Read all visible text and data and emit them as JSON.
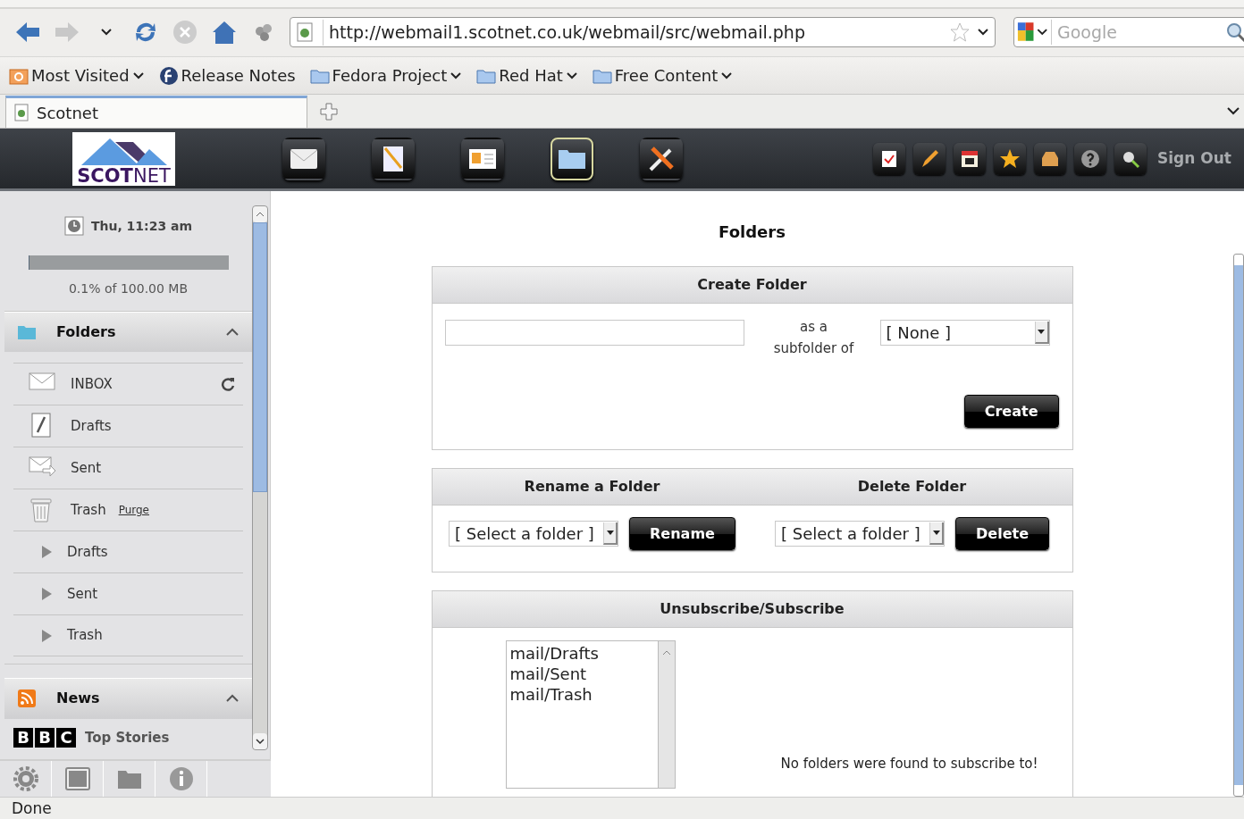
{
  "browser": {
    "url": "http://webmail1.scotnet.co.uk/webmail/src/webmail.php",
    "search": {
      "placeholder": "Google"
    },
    "bookmarks": [
      {
        "label": "Most Visited",
        "has_menu": true,
        "kind": "smart"
      },
      {
        "label": "Release Notes",
        "has_menu": false,
        "kind": "fedora"
      },
      {
        "label": "Fedora Project",
        "has_menu": true,
        "kind": "folder"
      },
      {
        "label": "Red Hat",
        "has_menu": true,
        "kind": "folder"
      },
      {
        "label": "Free Content",
        "has_menu": true,
        "kind": "folder"
      }
    ],
    "tabs": [
      {
        "label": "Scotnet",
        "selected": true
      }
    ]
  },
  "app": {
    "logo": {
      "first": "SCOT",
      "second": "NET"
    },
    "modules": [
      {
        "kind": "mail",
        "selected": false
      },
      {
        "kind": "compose",
        "selected": false
      },
      {
        "kind": "contacts",
        "selected": false
      },
      {
        "kind": "folders",
        "selected": true
      },
      {
        "kind": "tools",
        "selected": false
      }
    ],
    "sign_out": "Sign Out"
  },
  "sidebar": {
    "clock": "Thu, 11:23 am",
    "quota": {
      "level": 0.001,
      "reading": "0.1% of 100.00 MB"
    },
    "folders_panel": {
      "title": "Folders",
      "expanded": true,
      "items": [
        {
          "kind": "inbox",
          "label": "INBOX",
          "refresh": true
        },
        {
          "kind": "drafts",
          "label": "Drafts"
        },
        {
          "kind": "sent",
          "label": "Sent"
        },
        {
          "kind": "trash",
          "label": "Trash",
          "link": "Purge"
        },
        {
          "kind": "subfolder",
          "label": "Drafts",
          "expanded": false
        },
        {
          "kind": "subfolder",
          "label": "Sent",
          "expanded": false
        },
        {
          "kind": "subfolder",
          "label": "Trash",
          "expanded": false
        }
      ]
    },
    "news_panel": {
      "title": "News",
      "expanded": true,
      "source_letters": [
        "B",
        "B",
        "C"
      ],
      "feed": "Top Stories"
    }
  },
  "main": {
    "title": "Folders",
    "create": {
      "title": "Create Folder",
      "label": "as a subfolder of",
      "parent": "[ None ]",
      "button": "Create"
    },
    "rename": {
      "title": "Rename a Folder",
      "select": "[ Select a folder ]",
      "button": "Rename"
    },
    "delete": {
      "title": "Delete Folder",
      "select": "[ Select a folder ]",
      "button": "Delete"
    },
    "subscribe": {
      "title": "Unsubscribe/Subscribe",
      "folders": [
        "mail/Drafts",
        "mail/Sent",
        "mail/Trash"
      ],
      "message": "No folders were found to subscribe to!"
    }
  },
  "status_bar": "Done"
}
